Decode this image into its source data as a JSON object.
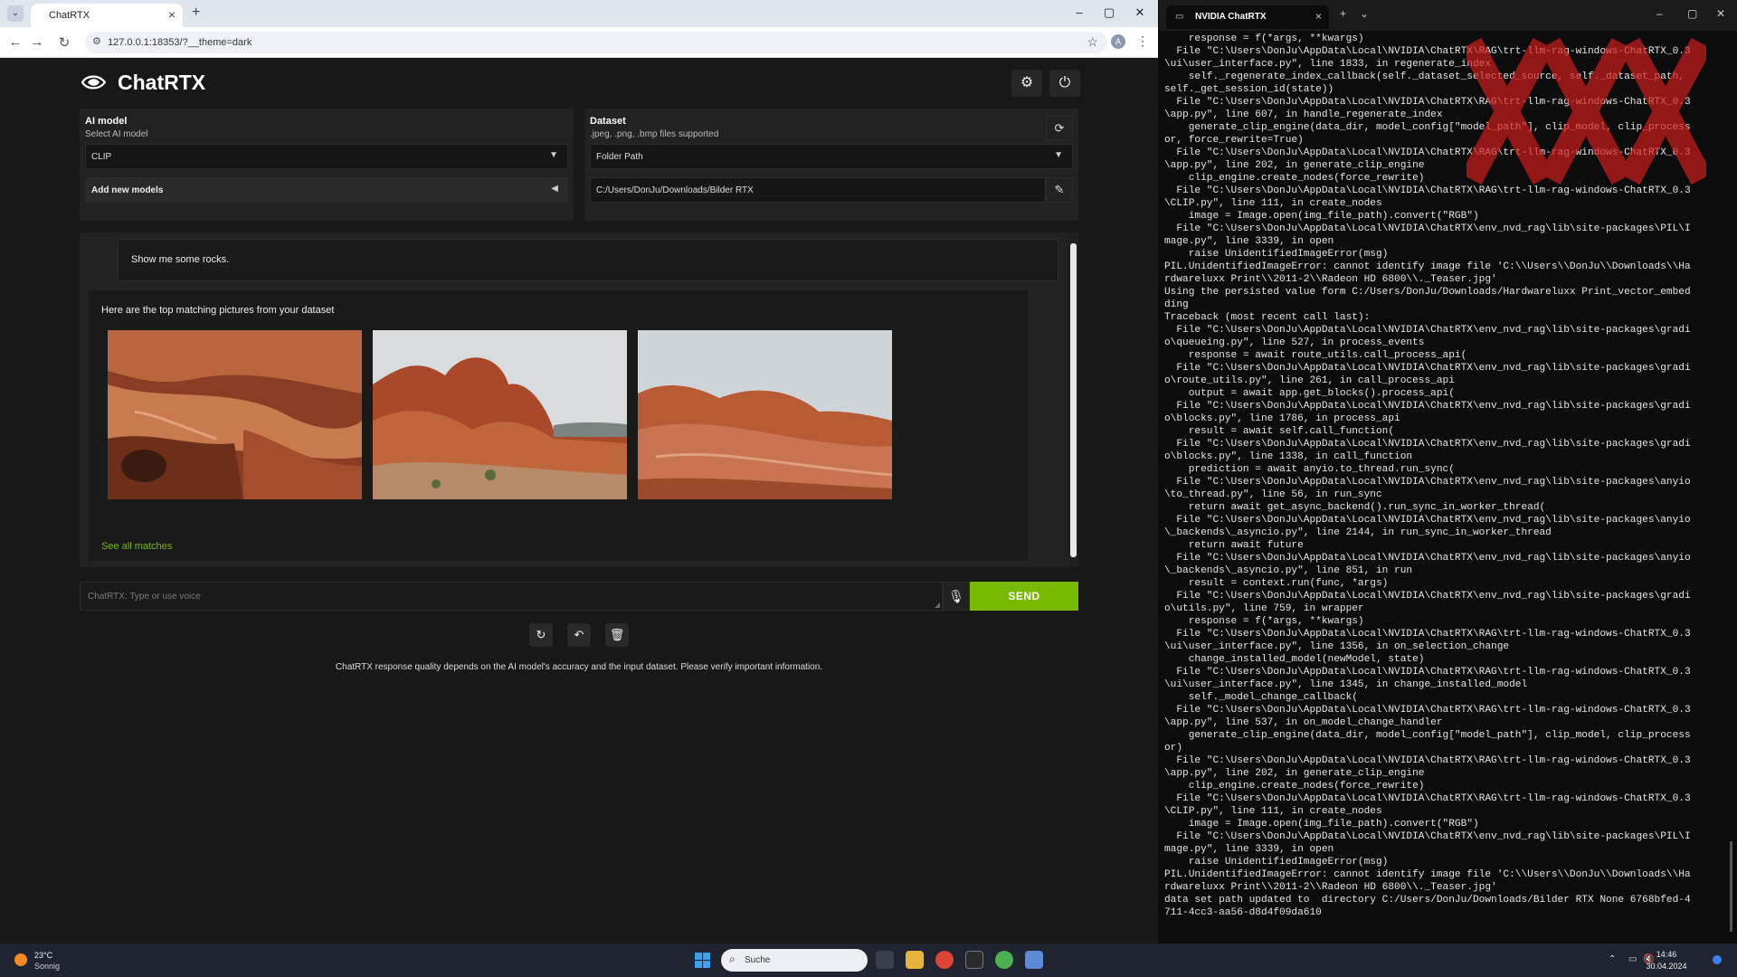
{
  "browser": {
    "tab_title": "ChatRTX",
    "new_tab_glyph": "+",
    "url": "127.0.0.1:18353/?__theme=dark",
    "profile_initial": "A"
  },
  "app": {
    "brand_name": "ChatRTX",
    "settings_icon": "gear-icon",
    "power_icon": "power-icon",
    "ai_model": {
      "title": "AI model",
      "subtitle": "Select AI model",
      "selected": "CLIP",
      "add_new_label": "Add new models"
    },
    "dataset": {
      "title": "Dataset",
      "subtitle": ".jpeg, .png, .bmp files supported",
      "source_selected": "Folder Path",
      "path_value": "C:/Users/DonJu/Downloads/Bilder RTX"
    },
    "chat": {
      "user_message": "Show me some rocks.",
      "bot_intro": "Here are the top matching pictures from your dataset",
      "see_all_label": "See all matches"
    },
    "composer": {
      "placeholder": "ChatRTX: Type or use voice",
      "send_label": "SEND"
    },
    "disclaimer": "ChatRTX response quality depends on the AI model's accuracy and the input dataset. Please verify important information.",
    "accent_color": "#76b900"
  },
  "terminal": {
    "tab_title": "NVIDIA ChatRTX",
    "lines": [
      "    response = f(*args, **kwargs)",
      "  File \"C:\\Users\\DonJu\\AppData\\Local\\NVIDIA\\ChatRTX\\RAG\\trt-llm-rag-windows-ChatRTX_0.3",
      "\\ui\\user_interface.py\", line 1833, in regenerate_index",
      "    self._regenerate_index_callback(self._dataset_selected_source, self._dataset_path,",
      "self._get_session_id(state))",
      "  File \"C:\\Users\\DonJu\\AppData\\Local\\NVIDIA\\ChatRTX\\RAG\\trt-llm-rag-windows-ChatRTX_0.3",
      "\\app.py\", line 607, in handle_regenerate_index",
      "    generate_clip_engine(data_dir, model_config[\"model_path\"], clip_model, clip_process",
      "or, force_rewrite=True)",
      "  File \"C:\\Users\\DonJu\\AppData\\Local\\NVIDIA\\ChatRTX\\RAG\\trt-llm-rag-windows-ChatRTX_0.3",
      "\\app.py\", line 202, in generate_clip_engine",
      "    clip_engine.create_nodes(force_rewrite)",
      "  File \"C:\\Users\\DonJu\\AppData\\Local\\NVIDIA\\ChatRTX\\RAG\\trt-llm-rag-windows-ChatRTX_0.3",
      "\\CLIP.py\", line 111, in create_nodes",
      "    image = Image.open(img_file_path).convert(\"RGB\")",
      "  File \"C:\\Users\\DonJu\\AppData\\Local\\NVIDIA\\ChatRTX\\env_nvd_rag\\lib\\site-packages\\PIL\\I",
      "mage.py\", line 3339, in open",
      "    raise UnidentifiedImageError(msg)",
      "PIL.UnidentifiedImageError: cannot identify image file 'C:\\\\Users\\\\DonJu\\\\Downloads\\\\Ha",
      "rdwareluxx Print\\\\2011-2\\\\Radeon HD 6800\\\\._Teaser.jpg'",
      "Using the persisted value form C:/Users/DonJu/Downloads/Hardwareluxx Print_vector_embed",
      "ding",
      "Traceback (most recent call last):",
      "  File \"C:\\Users\\DonJu\\AppData\\Local\\NVIDIA\\ChatRTX\\env_nvd_rag\\lib\\site-packages\\gradi",
      "o\\queueing.py\", line 527, in process_events",
      "    response = await route_utils.call_process_api(",
      "  File \"C:\\Users\\DonJu\\AppData\\Local\\NVIDIA\\ChatRTX\\env_nvd_rag\\lib\\site-packages\\gradi",
      "o\\route_utils.py\", line 261, in call_process_api",
      "    output = await app.get_blocks().process_api(",
      "  File \"C:\\Users\\DonJu\\AppData\\Local\\NVIDIA\\ChatRTX\\env_nvd_rag\\lib\\site-packages\\gradi",
      "o\\blocks.py\", line 1786, in process_api",
      "    result = await self.call_function(",
      "  File \"C:\\Users\\DonJu\\AppData\\Local\\NVIDIA\\ChatRTX\\env_nvd_rag\\lib\\site-packages\\gradi",
      "o\\blocks.py\", line 1338, in call_function",
      "    prediction = await anyio.to_thread.run_sync(",
      "  File \"C:\\Users\\DonJu\\AppData\\Local\\NVIDIA\\ChatRTX\\env_nvd_rag\\lib\\site-packages\\anyio",
      "\\to_thread.py\", line 56, in run_sync",
      "    return await get_async_backend().run_sync_in_worker_thread(",
      "  File \"C:\\Users\\DonJu\\AppData\\Local\\NVIDIA\\ChatRTX\\env_nvd_rag\\lib\\site-packages\\anyio",
      "\\_backends\\_asyncio.py\", line 2144, in run_sync_in_worker_thread",
      "    return await future",
      "  File \"C:\\Users\\DonJu\\AppData\\Local\\NVIDIA\\ChatRTX\\env_nvd_rag\\lib\\site-packages\\anyio",
      "\\_backends\\_asyncio.py\", line 851, in run",
      "    result = context.run(func, *args)",
      "  File \"C:\\Users\\DonJu\\AppData\\Local\\NVIDIA\\ChatRTX\\env_nvd_rag\\lib\\site-packages\\gradi",
      "o\\utils.py\", line 759, in wrapper",
      "    response = f(*args, **kwargs)",
      "  File \"C:\\Users\\DonJu\\AppData\\Local\\NVIDIA\\ChatRTX\\RAG\\trt-llm-rag-windows-ChatRTX_0.3",
      "\\ui\\user_interface.py\", line 1356, in on_selection_change",
      "    change_installed_model(newModel, state)",
      "  File \"C:\\Users\\DonJu\\AppData\\Local\\NVIDIA\\ChatRTX\\RAG\\trt-llm-rag-windows-ChatRTX_0.3",
      "\\ui\\user_interface.py\", line 1345, in change_installed_model",
      "    self._model_change_callback(",
      "  File \"C:\\Users\\DonJu\\AppData\\Local\\NVIDIA\\ChatRTX\\RAG\\trt-llm-rag-windows-ChatRTX_0.3",
      "\\app.py\", line 537, in on_model_change_handler",
      "    generate_clip_engine(data_dir, model_config[\"model_path\"], clip_model, clip_process",
      "or)",
      "  File \"C:\\Users\\DonJu\\AppData\\Local\\NVIDIA\\ChatRTX\\RAG\\trt-llm-rag-windows-ChatRTX_0.3",
      "\\app.py\", line 202, in generate_clip_engine",
      "    clip_engine.create_nodes(force_rewrite)",
      "  File \"C:\\Users\\DonJu\\AppData\\Local\\NVIDIA\\ChatRTX\\RAG\\trt-llm-rag-windows-ChatRTX_0.3",
      "\\CLIP.py\", line 111, in create_nodes",
      "    image = Image.open(img_file_path).convert(\"RGB\")",
      "  File \"C:\\Users\\DonJu\\AppData\\Local\\NVIDIA\\ChatRTX\\env_nvd_rag\\lib\\site-packages\\PIL\\I",
      "mage.py\", line 3339, in open",
      "    raise UnidentifiedImageError(msg)",
      "PIL.UnidentifiedImageError: cannot identify image file 'C:\\\\Users\\\\DonJu\\\\Downloads\\\\Ha",
      "rdwareluxx Print\\\\2011-2\\\\Radeon HD 6800\\\\._Teaser.jpg'",
      "data set path updated to  directory C:/Users/DonJu/Downloads/Bilder RTX None 6768bfed-4",
      "711-4cc3-aa56-d8d4f09da610"
    ]
  },
  "taskbar": {
    "temperature": "23°C",
    "weather": "Sonnig",
    "search_label": "Suche",
    "time": "14:46",
    "date": "30.04.2024"
  }
}
